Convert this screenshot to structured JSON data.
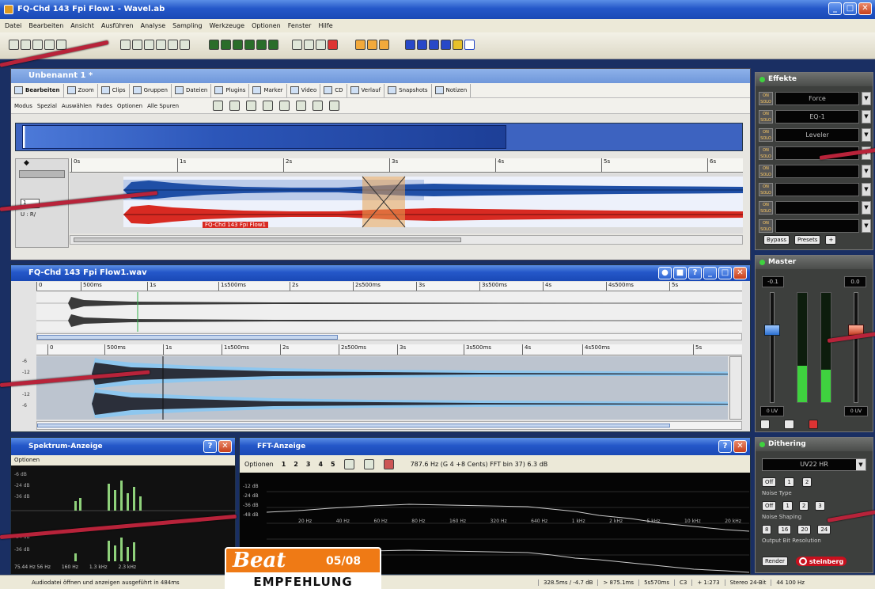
{
  "app": {
    "title": "FQ-Chd 143 Fpi Flow1 - Wavel.ab",
    "menu": [
      "Datei",
      "Bearbeiten",
      "Ansicht",
      "Ausführen",
      "Analyse",
      "Sampling",
      "Werkzeuge",
      "Optionen",
      "Fenster",
      "Hilfe"
    ]
  },
  "project": {
    "title": "Unbenannt 1 *",
    "tabs": [
      "Bearbeiten",
      "Zoom",
      "Clips",
      "Gruppen",
      "Dateien",
      "Plugins",
      "Marker",
      "Video",
      "CD",
      "Verlauf",
      "Snapshots",
      "Notizen"
    ],
    "subtoolbar": [
      "Modus",
      "Spezial",
      "Auswählen",
      "Fades",
      "Optionen",
      "Alle Spuren"
    ],
    "clip_label": "FQ-Chd 143 Fpi Flow1",
    "ruler": [
      "0s",
      "1s",
      "2s",
      "3s",
      "4s",
      "5s",
      "6s"
    ],
    "track_number": "1",
    "track_io": "U : R/"
  },
  "wave_window": {
    "title": "FQ-Chd 143 Fpi Flow1.wav",
    "overview_ruler": [
      "0",
      "500ms",
      "1s",
      "1s500ms",
      "2s",
      "2s500ms",
      "3s",
      "3s500ms",
      "4s",
      "4s500ms",
      "5s"
    ],
    "detail_ruler": [
      "0",
      "500ms",
      "1s",
      "1s500ms",
      "2s",
      "2s500ms",
      "3s",
      "3s500ms",
      "4s",
      "4s500ms",
      "5s"
    ],
    "db_labels": [
      "-6",
      "-12",
      "-6",
      "-12",
      "-6"
    ]
  },
  "spectrum": {
    "title": "Spektrum-Anzeige",
    "menu": "Optionen",
    "db_top": [
      "-6 dB",
      "-24 dB",
      "-36 dB"
    ],
    "db_bottom": [
      "-24 dB",
      "-36 dB"
    ],
    "freq_labels": [
      "75.44 Hz 56 Hz",
      "160 Hz",
      "1.3 kHz",
      "2.3 kHz",
      "16 kHz",
      "20 kHz"
    ]
  },
  "fft": {
    "title": "FFT-Anzeige",
    "menu": "Optionen",
    "channels": [
      "1",
      "2",
      "3",
      "4",
      "5"
    ],
    "readout": "787.6 Hz (G 4 +8 Cents) FFT bin 37) 6.3 dB",
    "db_labels": [
      "-12 dB",
      "-24 dB",
      "-36 dB",
      "-48 dB"
    ],
    "freq_labels": [
      "20 Hz",
      "40 Hz",
      "60 Hz",
      "80 Hz",
      "160 Hz",
      "320 Hz",
      "640 Hz",
      "1 kHz",
      "2 kHz",
      "5 kHz",
      "10 kHz",
      "20 kHz"
    ]
  },
  "effects": {
    "title": "Effekte",
    "slots": [
      "Force",
      "EQ-1",
      "Leveler",
      "",
      "",
      "",
      "",
      ""
    ],
    "bypass": "Bypass",
    "presets": "Presets"
  },
  "master": {
    "title": "Master",
    "left_value": "-0.1",
    "right_value": "0.0",
    "left_bottom": "0 UV",
    "right_bottom": "0 UV",
    "left_level": 0.33,
    "right_level": 0.3
  },
  "dithering": {
    "title": "Dithering",
    "preset": "UV22 HR",
    "row1_label": "Noise Type",
    "row2_label": "Noise Shaping",
    "row3_label": "Output Bit Resolution",
    "render": "Render",
    "brand": "steinberg"
  },
  "status": {
    "message": "Audiodatei öffnen und anzeigen ausgeführt in 484ms",
    "fields": [
      "328.5ms / -4.7 dB",
      "> 875.1ms",
      "5s570ms",
      "C3",
      "+ 1:273",
      "Stereo 24-Bit",
      "44 100 Hz"
    ]
  },
  "badge": {
    "brand": "Beat",
    "issue": "05/08",
    "label": "EMPFEHLUNG"
  },
  "colors": {
    "xp_blue": "#2457c8",
    "wave_blue": "#1f4fa6",
    "wave_red": "#d82a22",
    "callout": "#b8233a",
    "badge_orange": "#ef7a15"
  }
}
